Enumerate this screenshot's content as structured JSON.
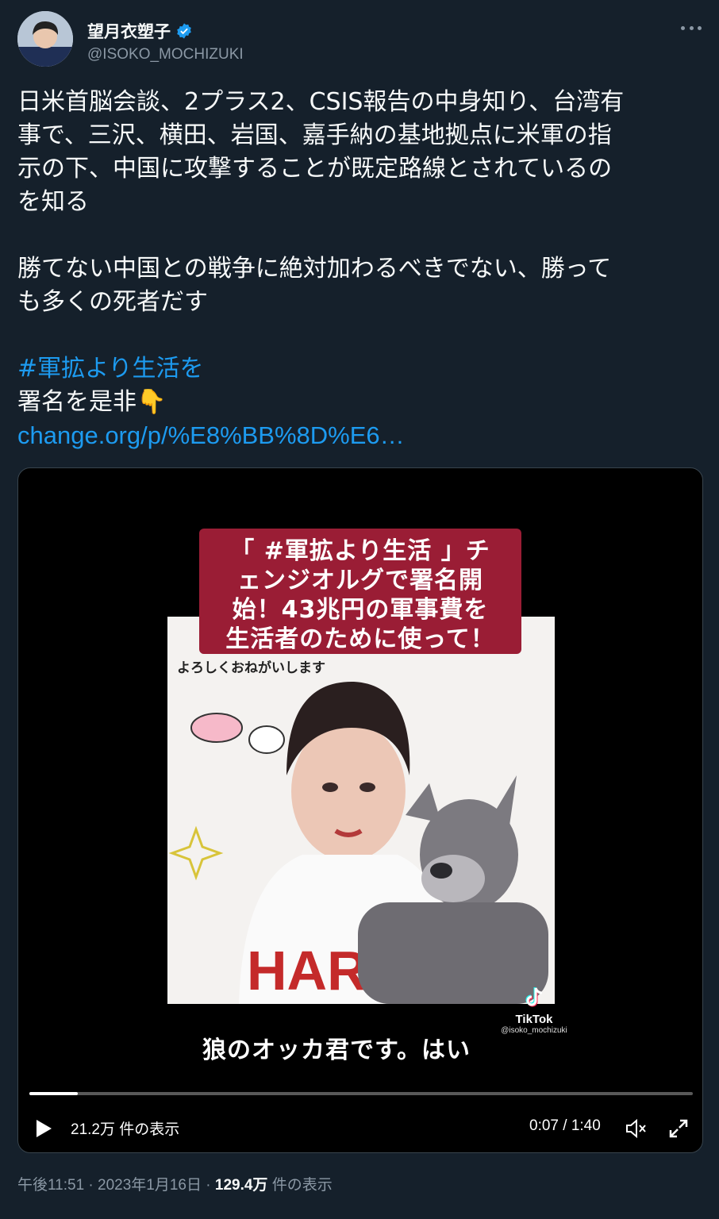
{
  "author": {
    "display_name": "望月衣塑子",
    "handle": "@ISOKO_MOCHIZUKI",
    "verified": true
  },
  "tweet": {
    "paragraph1_lines": [
      "日米首脳会談、2プラス2、CSIS報告の中身知り、台湾有",
      "事で、三沢、横田、岩国、嘉手納の基地拠点に米軍の指",
      "示の下、中国に攻撃することが既定路線とされているの",
      "を知る"
    ],
    "paragraph2_lines": [
      "勝てない中国との戦争に絶対加わるべきでない、勝って",
      "も多くの死者だす"
    ],
    "hashtag": "#軍拡より生活を",
    "sign_prompt": "署名を是非👇",
    "link": "change.org/p/%E8%BB%8D%E6…"
  },
  "video": {
    "caption_lines": [
      "「 #軍拡より生活 」チ",
      "ェンジオルグで署名開",
      "始！43兆円の軍事費を",
      "生活者のために使って！"
    ],
    "sticker_text": "よろしくおねがいします",
    "subtitle": "狼のオッカ君です。はい",
    "tiktok_name": "TikTok",
    "tiktok_handle": "@isoko_mochizuki",
    "progress": 0.073,
    "views": "21.2万 件の表示",
    "time": "0:07 / 1:40"
  },
  "meta": {
    "posted": "午後11:51 · 2023年1月16日 · ",
    "view_count": "129.4万",
    "view_suffix": " 件の表示"
  },
  "colors": {
    "background": "#15202b",
    "link": "#1d9bf0",
    "secondary_text": "#8b98a5",
    "caption_box": "#9a1d35"
  }
}
